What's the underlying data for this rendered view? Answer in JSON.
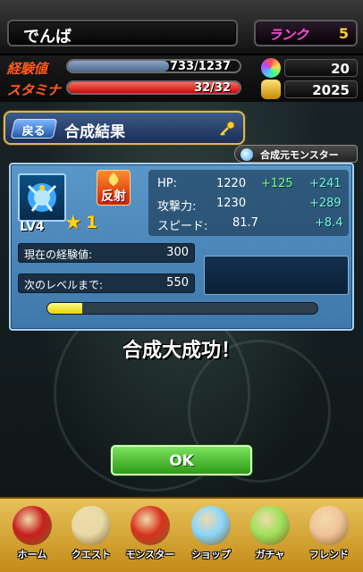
{
  "header": {
    "player_name": "でんば",
    "rank_label": "ランク",
    "rank_value": "5"
  },
  "status": {
    "exp_label": "経験値",
    "exp_text": "733/1237",
    "exp_fraction": 0.59,
    "stamina_label": "スタミナ",
    "stamina_text": "32/32",
    "stamina_fraction": 1.0,
    "orb_count": "20",
    "gold_count": "2025"
  },
  "title": {
    "back_label": "戻る",
    "text": "合成結果"
  },
  "tag": {
    "label": "合成元モンスター"
  },
  "monster": {
    "level": "LV4",
    "star": "★",
    "rarity": "1",
    "ability": "反射",
    "stats": {
      "hp_label": "HP:",
      "hp": "1220",
      "hp_bonus": "+125",
      "hp_total_bonus": "+241",
      "atk_label": "攻撃力:",
      "atk": "1230",
      "atk_bonus": "+289",
      "spd_label": "スピード:",
      "spd": "81.7",
      "spd_bonus": "+8.4"
    },
    "current_exp_label": "現在の経験値:",
    "current_exp": "300",
    "next_level_label": "次のレベルまで:",
    "next_level": "550",
    "exp_progress": 0.13
  },
  "result_message": "合成大成功！",
  "ok_label": "OK",
  "nav": [
    {
      "label": "ホーム",
      "icon": "home-icon",
      "color": "#c81e1e"
    },
    {
      "label": "クエスト",
      "icon": "scroll-icon",
      "color": "#e9d9a8"
    },
    {
      "label": "モンスター",
      "icon": "monster-icon",
      "color": "#d8321e"
    },
    {
      "label": "ショップ",
      "icon": "orb-icon",
      "color": "#8ad6ff"
    },
    {
      "label": "ガチャ",
      "icon": "egg-icon",
      "color": "#9fe15a"
    },
    {
      "label": "フレンド",
      "icon": "handshake-icon",
      "color": "#f0c49a"
    }
  ]
}
